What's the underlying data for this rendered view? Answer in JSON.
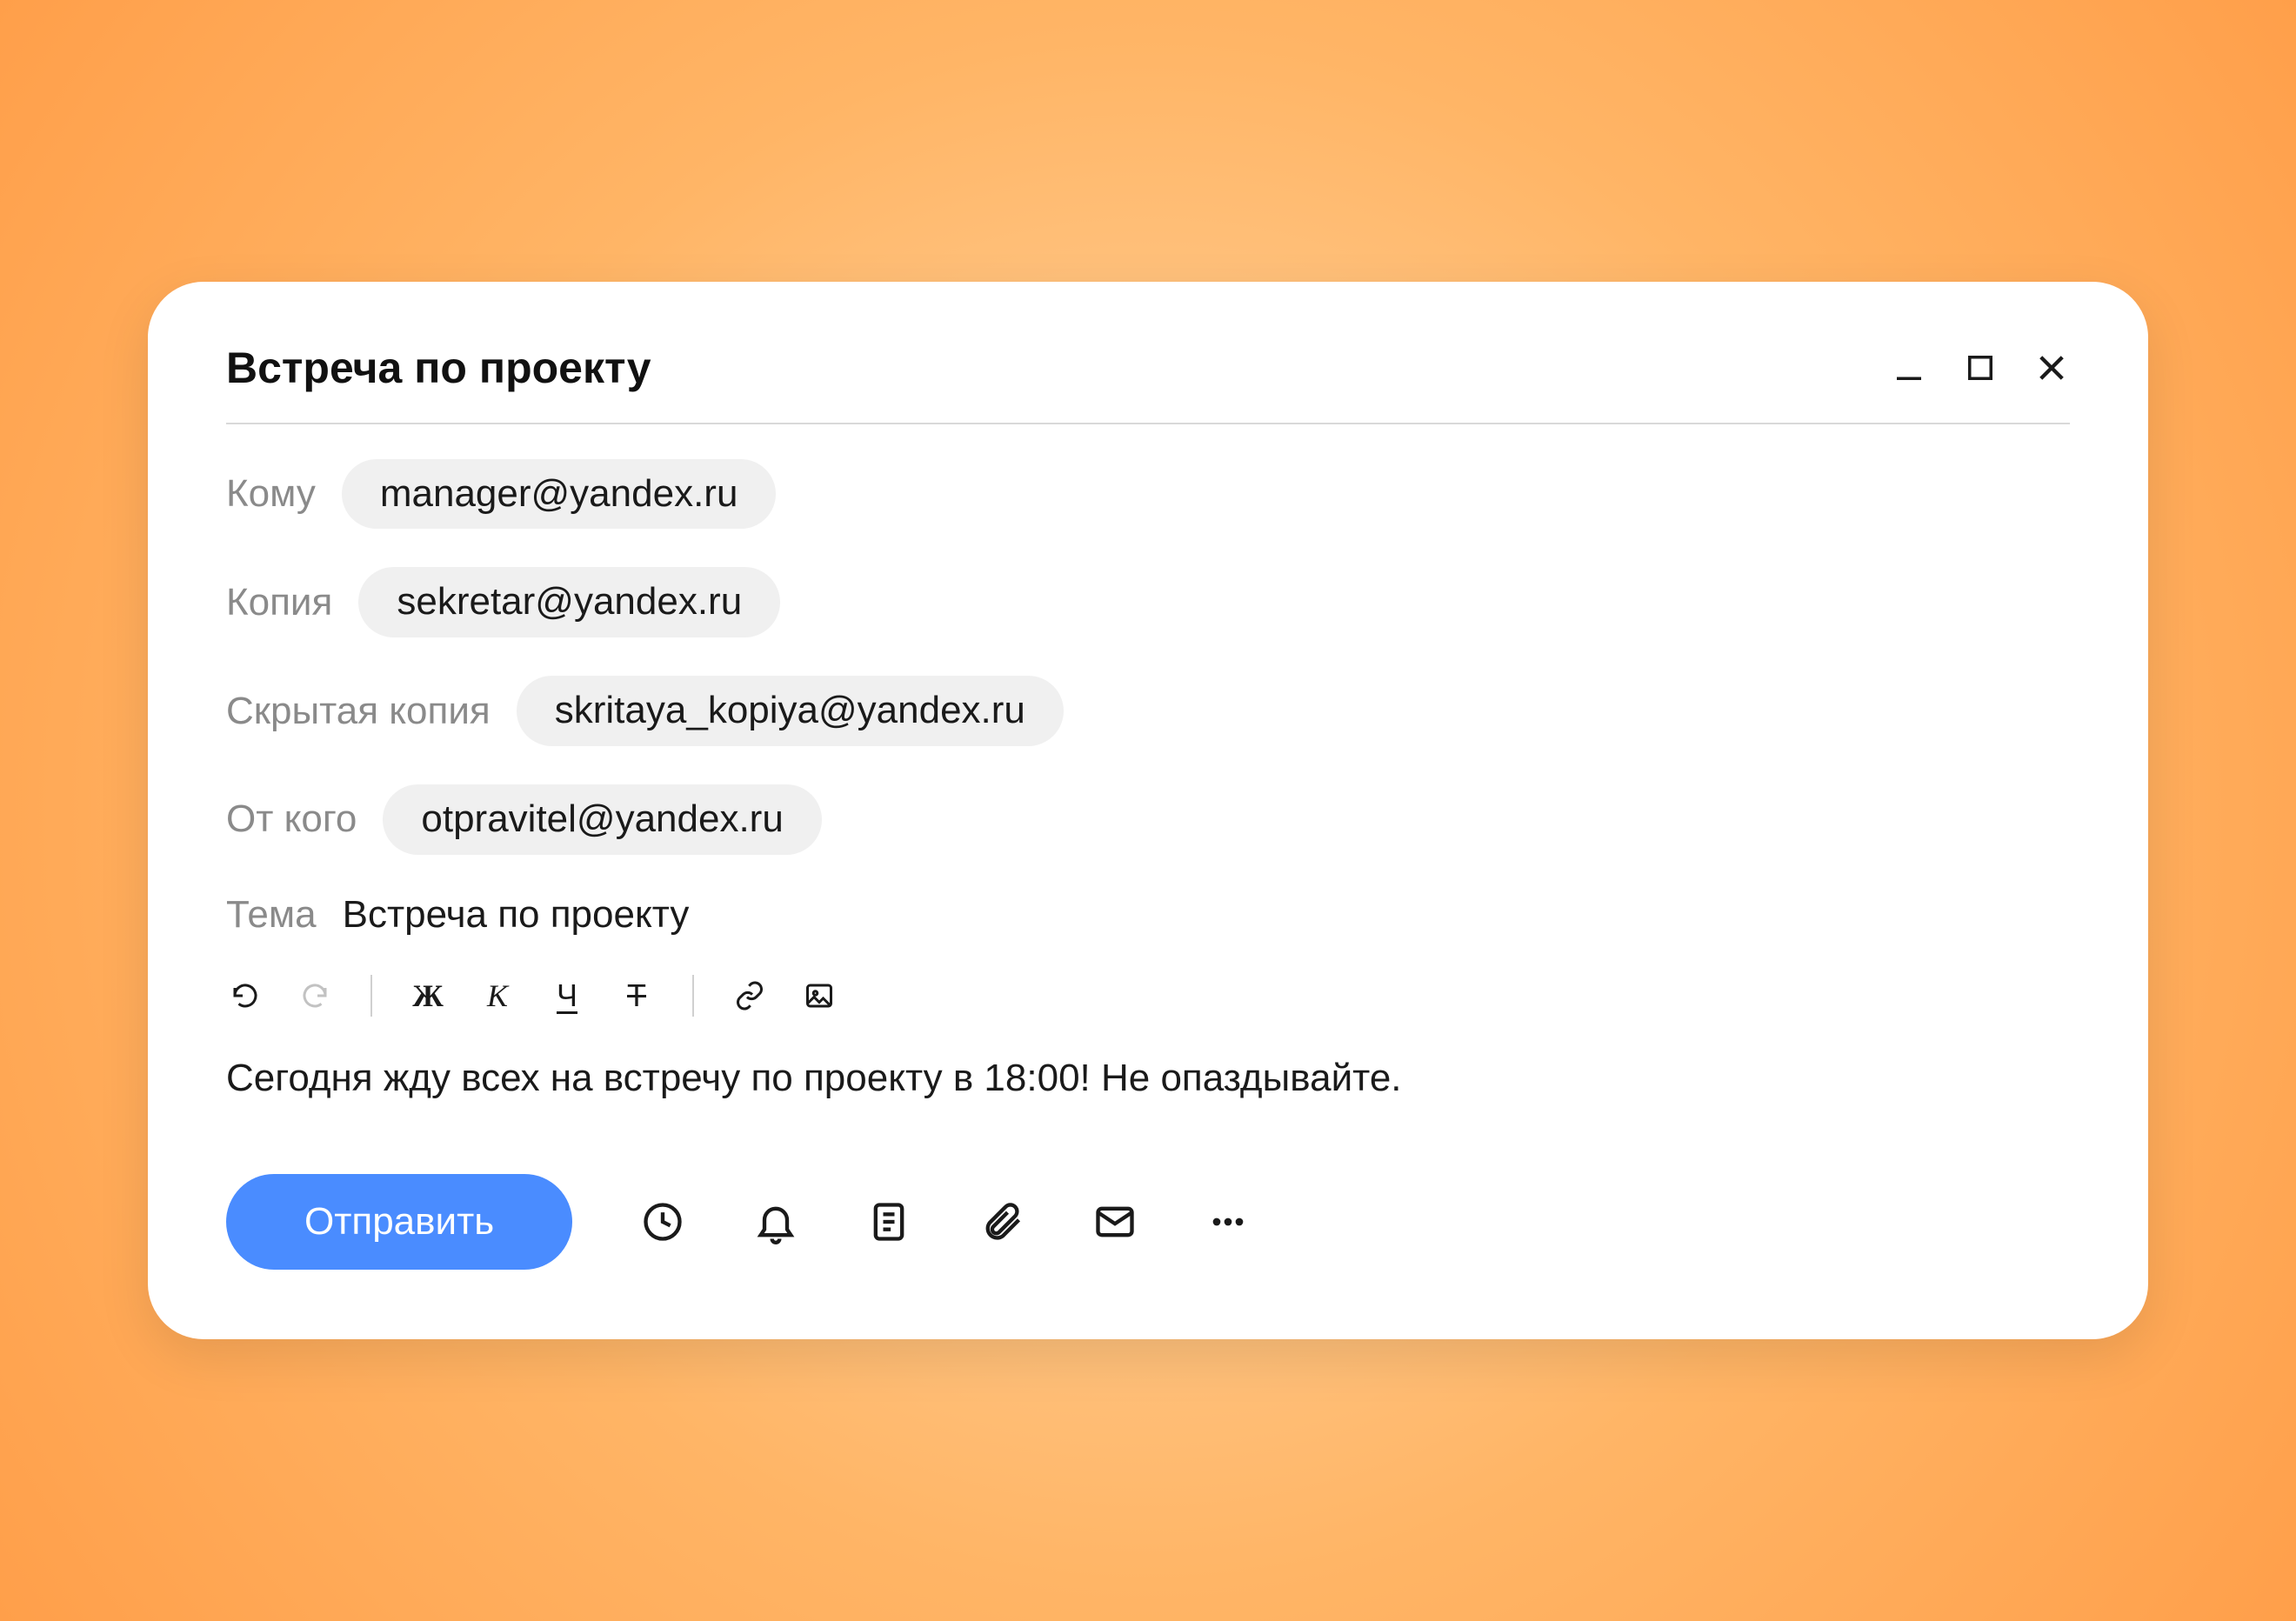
{
  "window": {
    "title": "Встреча по проекту"
  },
  "fields": {
    "to_label": "Кому",
    "to_value": "manager@yandex.ru",
    "cc_label": "Копия",
    "cc_value": "sekretar@yandex.ru",
    "bcc_label": "Скрытая копия",
    "bcc_value": "skritaya_kopiya@yandex.ru",
    "from_label": "От кого",
    "from_value": "otpravitel@yandex.ru",
    "subject_label": "Тема",
    "subject_value": "Встреча по проекту"
  },
  "toolbar": {
    "bold_glyph": "Ж",
    "italic_glyph": "К",
    "underline_glyph": "Ч",
    "strike_glyph": "Т"
  },
  "body": {
    "text": "Сегодня жду всех на встречу по проекту в 18:00! Не  опаздывайте."
  },
  "footer": {
    "send_label": "Отправить"
  }
}
